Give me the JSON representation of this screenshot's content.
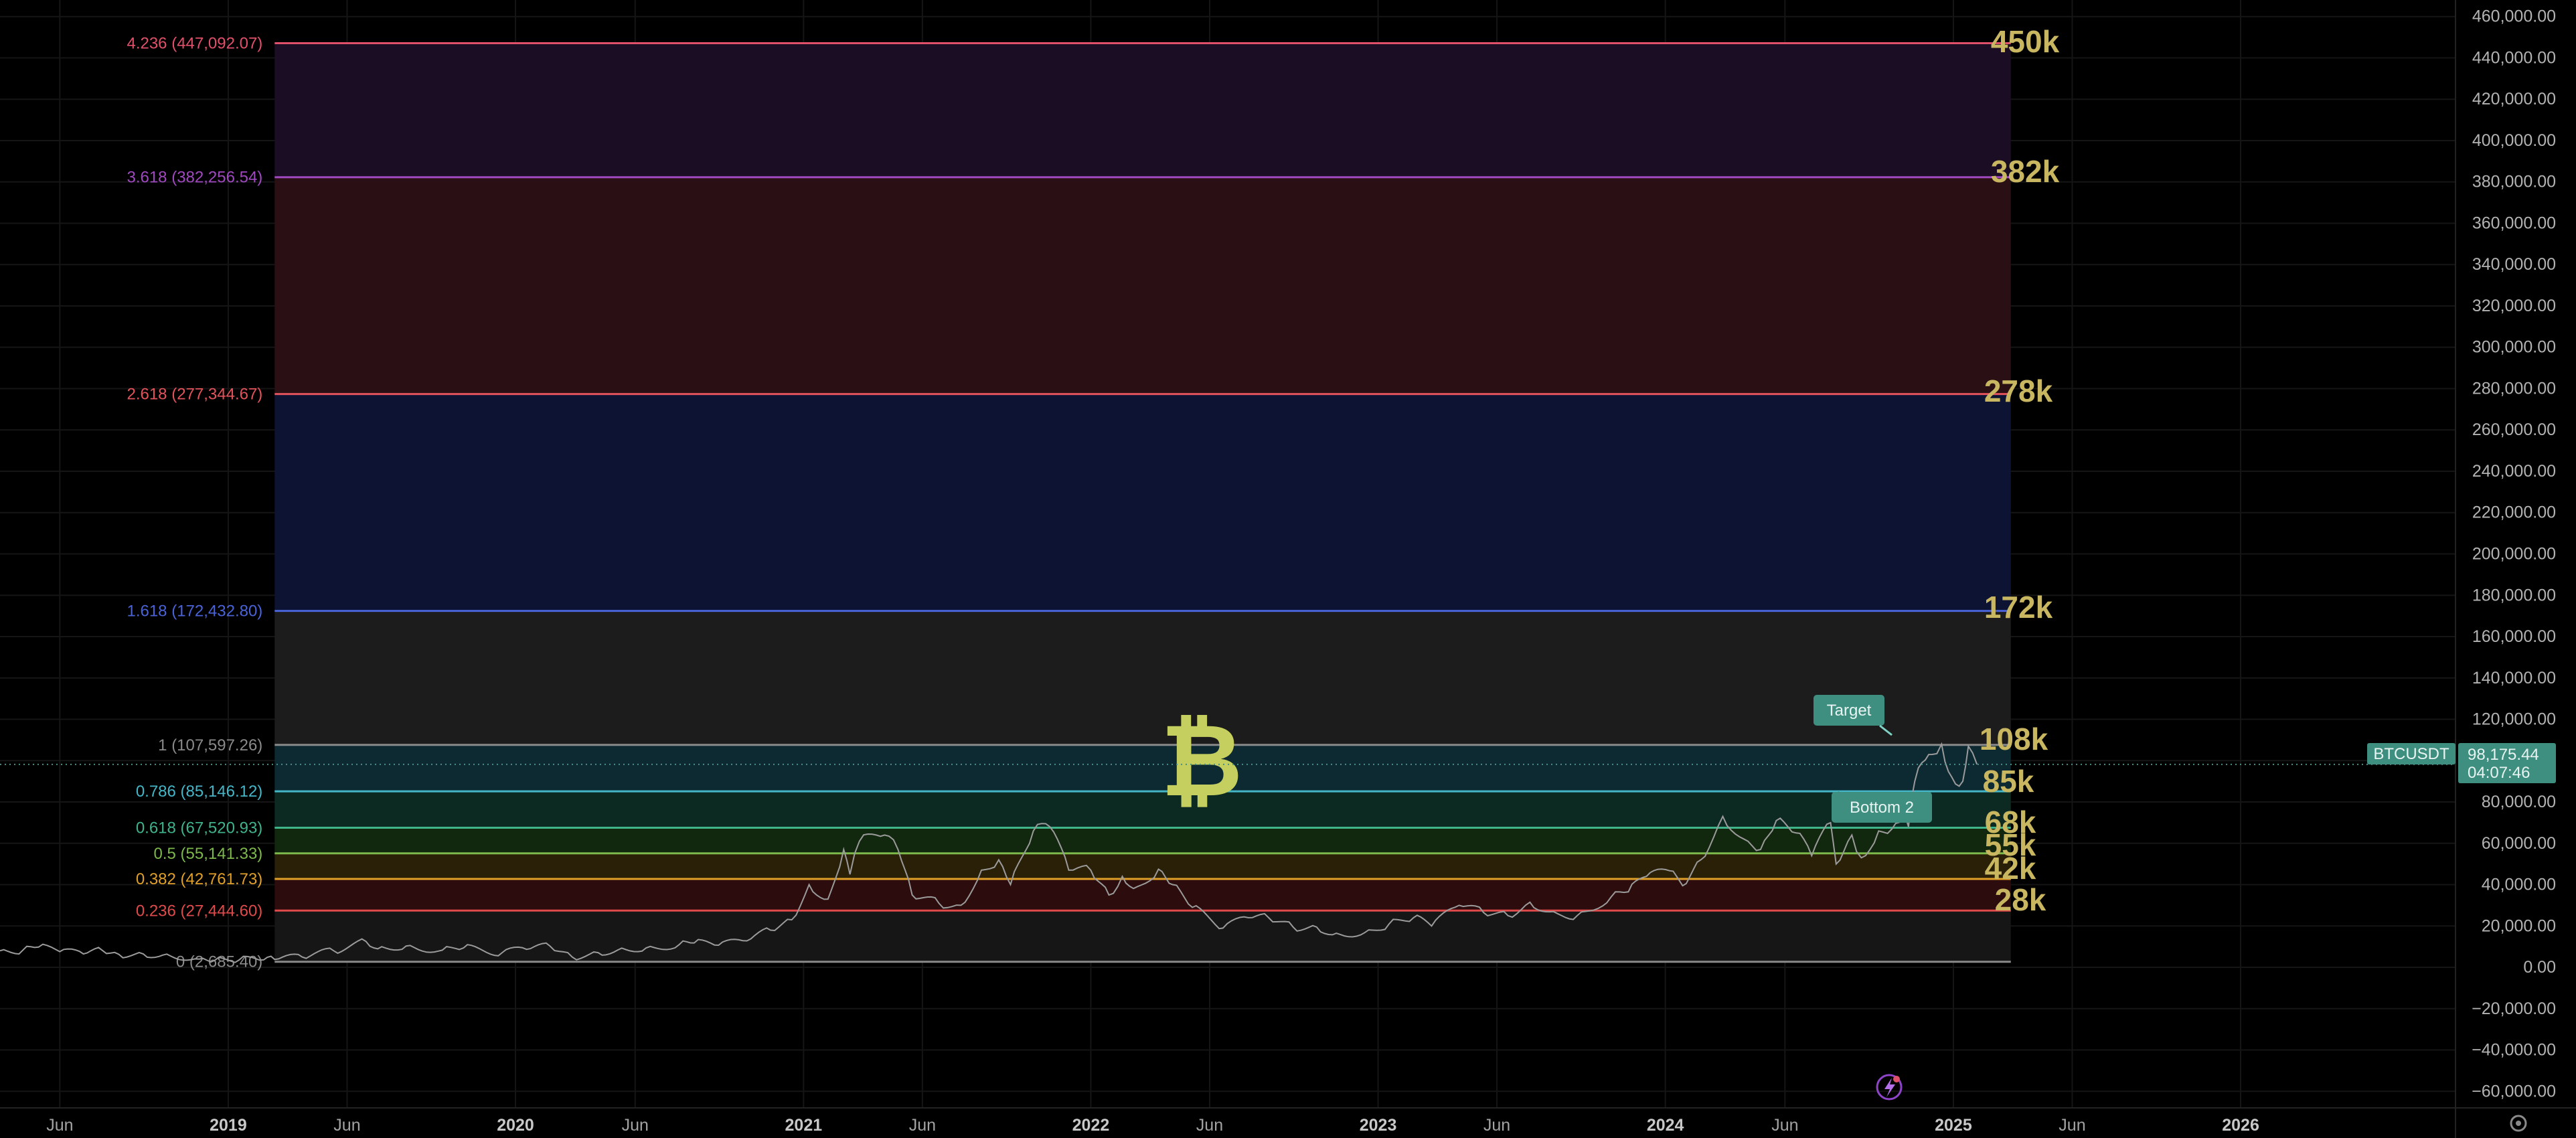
{
  "symbol": {
    "name": "BTCUSDT",
    "price_label": "98,175.44",
    "countdown": "04:07:46",
    "last_price": 98175.44
  },
  "colors": {
    "background": "#000000",
    "price_line": "#9b9b9b",
    "badge": "#3f8f80",
    "big_label": "#c9b660",
    "bitcoin_logo": "#c5cf5f"
  },
  "annotations": {
    "target": "Target",
    "bottom": "Bottom 2",
    "logo_glyph": "₿"
  },
  "chart_data": {
    "type": "line",
    "title": "",
    "xlabel": "",
    "ylabel": "",
    "ylim": [
      -68000,
      468000
    ],
    "xlim": [
      "2018-03-17",
      "2026-10-01"
    ],
    "y_tick_labels": [
      "460,000.00",
      "440,000.00",
      "420,000.00",
      "400,000.00",
      "380,000.00",
      "360,000.00",
      "340,000.00",
      "320,000.00",
      "300,000.00",
      "280,000.00",
      "260,000.00",
      "240,000.00",
      "220,000.00",
      "200,000.00",
      "180,000.00",
      "160,000.00",
      "140,000.00",
      "120,000.00",
      "100,000.00",
      "80,000.00",
      "60,000.00",
      "40,000.00",
      "20,000.00",
      "0.00",
      "−20,000.00",
      "−40,000.00",
      "−60,000.00"
    ],
    "y_tick_values": [
      460000,
      440000,
      420000,
      400000,
      380000,
      360000,
      340000,
      320000,
      300000,
      280000,
      260000,
      240000,
      220000,
      200000,
      180000,
      160000,
      140000,
      120000,
      100000,
      80000,
      60000,
      40000,
      20000,
      0,
      -20000,
      -40000,
      -60000
    ],
    "x_ticks": [
      {
        "label": "Jun",
        "date": "2018-06-01",
        "bold": false
      },
      {
        "label": "2019",
        "date": "2019-01-01",
        "bold": true
      },
      {
        "label": "Jun",
        "date": "2019-06-01",
        "bold": false
      },
      {
        "label": "2020",
        "date": "2020-01-01",
        "bold": true
      },
      {
        "label": "Jun",
        "date": "2020-06-01",
        "bold": false
      },
      {
        "label": "2021",
        "date": "2021-01-01",
        "bold": true
      },
      {
        "label": "Jun",
        "date": "2021-06-01",
        "bold": false
      },
      {
        "label": "2022",
        "date": "2022-01-01",
        "bold": true
      },
      {
        "label": "Jun",
        "date": "2022-06-01",
        "bold": false
      },
      {
        "label": "2023",
        "date": "2023-01-01",
        "bold": true
      },
      {
        "label": "Jun",
        "date": "2023-06-01",
        "bold": false
      },
      {
        "label": "2024",
        "date": "2024-01-01",
        "bold": true
      },
      {
        "label": "Jun",
        "date": "2024-06-01",
        "bold": false
      },
      {
        "label": "2025",
        "date": "2025-01-01",
        "bold": true
      },
      {
        "label": "Jun",
        "date": "2025-06-01",
        "bold": false
      },
      {
        "label": "2026",
        "date": "2026-01-01",
        "bold": true
      }
    ],
    "fib": {
      "start_date": "2019-03-01",
      "end_date": "2025-03-15",
      "levels": [
        {
          "ratio": "4.236",
          "price": 447092.07,
          "label": "4.236 (447,092.07)",
          "big_label": "450k",
          "color": "#e0506a",
          "fill": "#1a0d24"
        },
        {
          "ratio": "3.618",
          "price": 382256.54,
          "label": "3.618 (382,256.54)",
          "big_label": "382k",
          "color": "#a048c0",
          "fill": "#2a1014"
        },
        {
          "ratio": "2.618",
          "price": 277344.67,
          "label": "2.618 (277,344.67)",
          "big_label": "278k",
          "color": "#e2535c",
          "fill": "#0d1433"
        },
        {
          "ratio": "1.618",
          "price": 172432.8,
          "label": "1.618 (172,432.80)",
          "big_label": "172k",
          "color": "#4a63d8",
          "fill": "#1c1c1c"
        },
        {
          "ratio": "1",
          "price": 107597.26,
          "label": "1 (107,597.26)",
          "big_label": "108k",
          "color": "#8a8a8a",
          "fill": "#0d2a32"
        },
        {
          "ratio": "0.786",
          "price": 85146.12,
          "label": "0.786 (85,146.12)",
          "big_label": "85k",
          "color": "#43b6c8",
          "fill": "#0d2a22"
        },
        {
          "ratio": "0.618",
          "price": 67520.93,
          "label": "0.618 (67,520.93)",
          "big_label": "68k",
          "color": "#3fb38a",
          "fill": "#12280e"
        },
        {
          "ratio": "0.5",
          "price": 55141.33,
          "label": "0.5 (55,141.33)",
          "big_label": "55k",
          "color": "#7cb84a",
          "fill": "#2a2008"
        },
        {
          "ratio": "0.382",
          "price": 42761.73,
          "label": "0.382 (42,761.73)",
          "big_label": "42k",
          "color": "#e0a028",
          "fill": "#2c0c0c"
        },
        {
          "ratio": "0.236",
          "price": 27444.6,
          "label": "0.236 (27,444.60)",
          "big_label": "28k",
          "color": "#e04a4a",
          "fill": "#161616"
        },
        {
          "ratio": "0",
          "price": 2685.4,
          "label": "0 (2,685.40)",
          "big_label": "",
          "color": "#8a8a8a",
          "fill": ""
        }
      ]
    },
    "series": [
      {
        "x": [
          "2018-03-17",
          "2018-04-15",
          "2018-05-05",
          "2018-06-01",
          "2018-07-01",
          "2018-07-25",
          "2018-08-15",
          "2018-09-15",
          "2018-10-15",
          "2018-11-25",
          "2018-12-15",
          "2019-01-15",
          "2019-02-15",
          "2019-03-01",
          "2019-04-05",
          "2019-05-15",
          "2019-06-25",
          "2019-07-15",
          "2019-08-15",
          "2019-09-30",
          "2019-10-27",
          "2019-12-15",
          "2020-01-15",
          "2020-02-14",
          "2020-03-13",
          "2020-04-15",
          "2020-05-15",
          "2020-06-15",
          "2020-07-27",
          "2020-08-15",
          "2020-09-15",
          "2020-10-21",
          "2020-11-20",
          "2020-12-17",
          "2021-01-08",
          "2021-02-01",
          "2021-02-21",
          "2021-03-01",
          "2021-03-13",
          "2021-04-14",
          "2021-05-01",
          "2021-05-19",
          "2021-06-22",
          "2021-07-20",
          "2021-08-15",
          "2021-09-06",
          "2021-09-21",
          "2021-10-20",
          "2021-11-10",
          "2021-12-04",
          "2022-01-01",
          "2022-01-24",
          "2022-02-10",
          "2022-03-01",
          "2022-03-28",
          "2022-04-15",
          "2022-05-10",
          "2022-06-18",
          "2022-07-20",
          "2022-08-15",
          "2022-09-15",
          "2022-10-15",
          "2022-11-09",
          "2022-12-15",
          "2023-01-15",
          "2023-02-15",
          "2023-03-10",
          "2023-04-14",
          "2023-05-15",
          "2023-06-15",
          "2023-07-13",
          "2023-08-17",
          "2023-09-11",
          "2023-10-24",
          "2023-11-15",
          "2023-12-08",
          "2024-01-11",
          "2024-01-23",
          "2024-02-15",
          "2024-03-14",
          "2024-04-15",
          "2024-05-01",
          "2024-05-21",
          "2024-06-15",
          "2024-07-05",
          "2024-07-29",
          "2024-08-05",
          "2024-08-25",
          "2024-09-06",
          "2024-09-28",
          "2024-10-15",
          "2024-10-29",
          "2024-11-05",
          "2024-11-13",
          "2024-11-22",
          "2024-12-05",
          "2024-12-17",
          "2024-12-30",
          "2025-01-13",
          "2025-01-20",
          "2025-01-31"
        ],
        "y": [
          8000,
          8300,
          9800,
          7600,
          6500,
          8200,
          6300,
          6500,
          6400,
          4000,
          3400,
          3600,
          3600,
          3800,
          5000,
          8000,
          12500,
          10000,
          10300,
          8300,
          9400,
          7100,
          8700,
          10200,
          5000,
          7100,
          9300,
          9400,
          11000,
          11800,
          10700,
          12800,
          18000,
          23000,
          40000,
          33000,
          57000,
          45000,
          61000,
          64000,
          57000,
          35000,
          31000,
          30000,
          47000,
          52000,
          40000,
          66000,
          68000,
          47000,
          47000,
          35000,
          44000,
          39000,
          47500,
          40000,
          29000,
          19000,
          24000,
          24000,
          19500,
          19500,
          16500,
          16800,
          21000,
          24000,
          20000,
          30000,
          26500,
          25000,
          31500,
          26000,
          25000,
          34000,
          36500,
          44000,
          46500,
          39500,
          52000,
          73000,
          61000,
          57000,
          71000,
          65000,
          54000,
          70000,
          50000,
          64000,
          53000,
          66000,
          67000,
          72000,
          68000,
          90000,
          99000,
          103000,
          108000,
          92000,
          90000,
          107000,
          98175
        ]
      }
    ]
  }
}
